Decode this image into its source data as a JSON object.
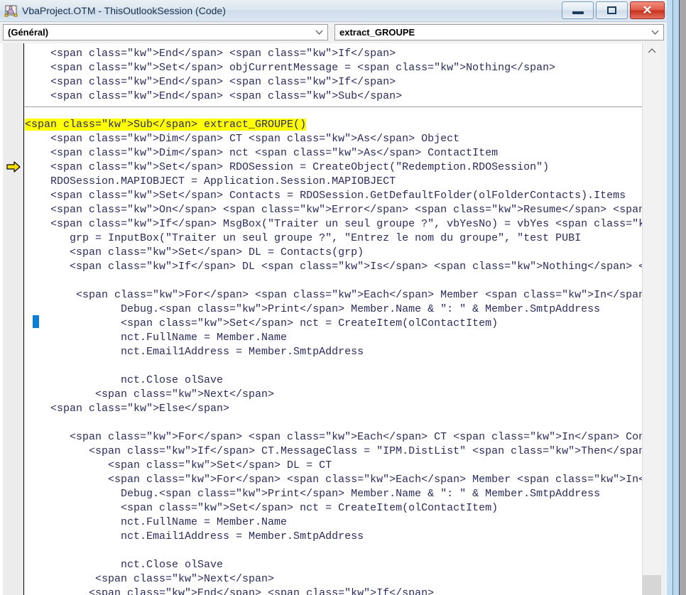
{
  "window": {
    "title": "VbaProject.OTM - ThisOutlookSession (Code)",
    "icon": "vba-project-icon",
    "buttons": {
      "minimize": "—",
      "restore": "❐",
      "close": "✕"
    }
  },
  "toolbar": {
    "object_combo": {
      "value": "(Général)",
      "arrow_icon": "chevron-down-icon"
    },
    "procedure_combo": {
      "value": "extract_GROUPE",
      "arrow_icon": "chevron-down-icon"
    }
  },
  "editor": {
    "execution_marker_icon": "yellow-right-arrow-icon",
    "highlight_color": "#ffff00",
    "caret_color": "#0b7fd4",
    "keyword_color": "#0000bf",
    "text_color": "#1c1c3c",
    "lines": [
      "    End If",
      "    Set objCurrentMessage = Nothing",
      "    End If",
      "    End Sub",
      "",
      "Sub extract_GROUPE()",
      "    Dim CT As Object",
      "    Dim nct As ContactItem",
      "    Set RDOSession = CreateObject(\"Redemption.RDOSession\")",
      "    RDOSession.MAPIOBJECT = Application.Session.MAPIOBJECT",
      "    Set Contacts = RDOSession.GetDefaultFolder(olFolderContacts).Items",
      "    On Error Resume Next",
      "    If MsgBox(\"Traiter un seul groupe ?\", vbYesNo) = vbYes Then",
      "       grp = InputBox(\"Traiter un seul groupe ?\", \"Entrez le nom du groupe\", \"test PUBI",
      "       Set DL = Contacts(grp)",
      "       If DL Is Nothing Then MsgBox \"pas trouvé\": Exit Sub",
      "",
      "        For Each Member In DL.OneOffMembers",
      "               Debug.Print Member.Name & \": \" & Member.SmtpAddress",
      "               Set nct = CreateItem(olContactItem)",
      "               nct.FullName = Member.Name",
      "               nct.Email1Address = Member.SmtpAddress",
      "",
      "               nct.Close olSave",
      "           Next",
      "    Else",
      "",
      "       For Each CT In Contacts",
      "          If CT.MessageClass = \"IPM.DistList\" Then",
      "             Set DL = CT",
      "             For Each Member In DL.OneOffMembers",
      "               Debug.Print Member.Name & \": \" & Member.SmtpAddress",
      "               Set nct = CreateItem(olContactItem)",
      "               nct.FullName = Member.Name",
      "               nct.Email1Address = Member.SmtpAddress",
      "",
      "               nct.Close olSave",
      "           Next",
      "          End If"
    ]
  },
  "scrollbar": {
    "up_arrow_icon": "chevron-up-icon"
  }
}
